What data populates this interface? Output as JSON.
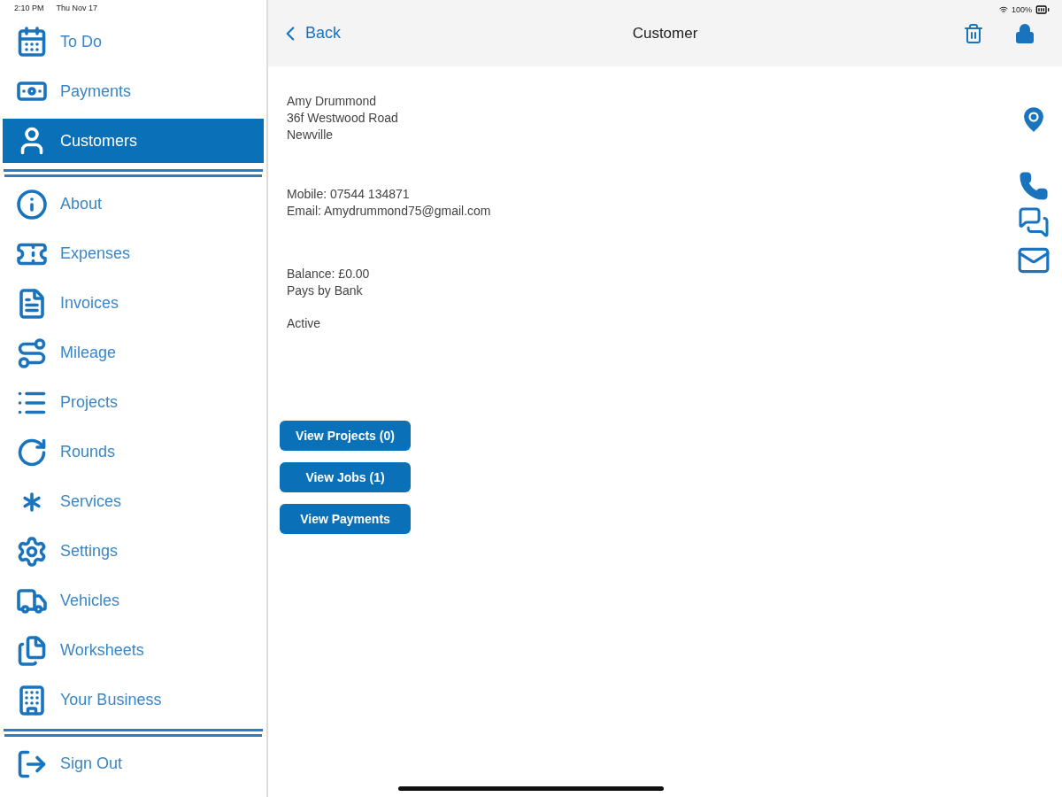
{
  "status_bar": {
    "time": "2:10 PM",
    "date": "Thu Nov 17",
    "battery": "100%"
  },
  "sidebar": {
    "sections": [
      [
        {
          "label": "To Do",
          "selected": false
        },
        {
          "label": "Payments",
          "selected": false
        },
        {
          "label": "Customers",
          "selected": true
        }
      ],
      [
        {
          "label": "About",
          "selected": false
        },
        {
          "label": "Expenses",
          "selected": false
        },
        {
          "label": "Invoices",
          "selected": false
        },
        {
          "label": "Mileage",
          "selected": false
        },
        {
          "label": "Projects",
          "selected": false
        },
        {
          "label": "Rounds",
          "selected": false
        },
        {
          "label": "Services",
          "selected": false
        },
        {
          "label": "Settings",
          "selected": false
        },
        {
          "label": "Vehicles",
          "selected": false
        },
        {
          "label": "Worksheets",
          "selected": false
        },
        {
          "label": "Your Business",
          "selected": false
        }
      ],
      [
        {
          "label": "Sign Out",
          "selected": false
        }
      ]
    ]
  },
  "nav_bar": {
    "back": "Back",
    "title": "Customer"
  },
  "customer": {
    "blocks": [
      [
        "Amy Drummond",
        "36f Westwood Road",
        "Newville"
      ],
      [
        "Mobile: 07544 134871",
        "Email: Amydrummond75@gmail.com"
      ],
      [
        "Balance: £0.00",
        "Pays by Bank"
      ],
      [
        "Active"
      ]
    ]
  },
  "actions": [
    "View Projects (0)",
    "View Jobs (1)",
    "View Payments"
  ]
}
